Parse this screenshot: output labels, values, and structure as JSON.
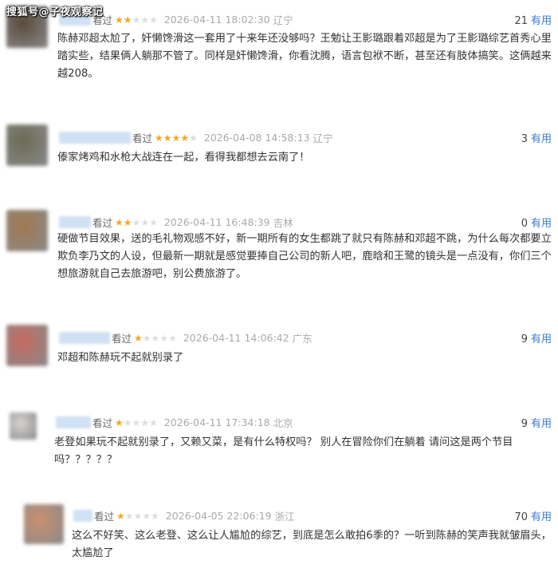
{
  "watermark": "搜狐号@子夜观察记",
  "useful_label": "有用",
  "comments": [
    {
      "watched": "看过",
      "rating": 2,
      "datetime": "2026-04-11 18:02:30",
      "region": "辽宁",
      "useful_count": "21",
      "text": "陈赫邓超太尬了，奸懒馋滑这一套用了十来年还没够吗？王勉让王影璐跟着邓超是为了王影璐综艺首秀心里踏实些，结果俩人躺那不管了。同样是奸懒馋滑，你看沈腾，语言包袱不断，甚至还有肢体搞笑。这俩越来越208。",
      "avatar_color": "#5a4a3c"
    },
    {
      "watched": "看过",
      "rating": 4,
      "datetime": "2026-04-08 14:58:13",
      "region": "辽宁",
      "useful_count": "3",
      "text": "傣家烤鸡和水枪大战连在一起，看得我都想去云南了！",
      "avatar_color": "#6b6b55"
    },
    {
      "watched": "看过",
      "rating": 2,
      "datetime": "2026-04-11 16:48:39",
      "region": "吉林",
      "useful_count": "0",
      "text": "硬做节目效果，送的毛礼物观感不好，新一期所有的女生都跳了就只有陈赫和邓超不跳，为什么每次都要立欺负李乃文的人设，但最新一期就是感觉要捧自己公司的新人吧，鹿晗和王鹭的镜头是一点没有，你们三个想旅游就自己去旅游吧，别公费旅游了。",
      "avatar_color": "#a07850"
    },
    {
      "watched": "看过",
      "rating": 1,
      "datetime": "2026-04-11 14:06:42",
      "region": "广东",
      "useful_count": "9",
      "text": "邓超和陈赫玩不起就别录了",
      "avatar_color": "#c46a60"
    },
    {
      "watched": "看过",
      "rating": 1,
      "datetime": "2026-04-11 17:34:18",
      "region": "北京",
      "useful_count": "9",
      "text": "老登如果玩不起就别录了，又赖又菜，是有什么特权吗？ 别人在冒险你们在躺着 请问这是两个节目吗？？？？？",
      "avatar_color": "#d8d4d2"
    },
    {
      "watched": "看过",
      "rating": 1,
      "datetime": "2026-04-05 22:06:19",
      "region": "浙江",
      "useful_count": "70",
      "text": "这么不好笑、这么老登、这么让人尴尬的综艺，到底是怎么敢拍6季的？一听到陈赫的笑声我就皱眉头，太尴尬了",
      "avatar_color": "#c89070"
    }
  ]
}
